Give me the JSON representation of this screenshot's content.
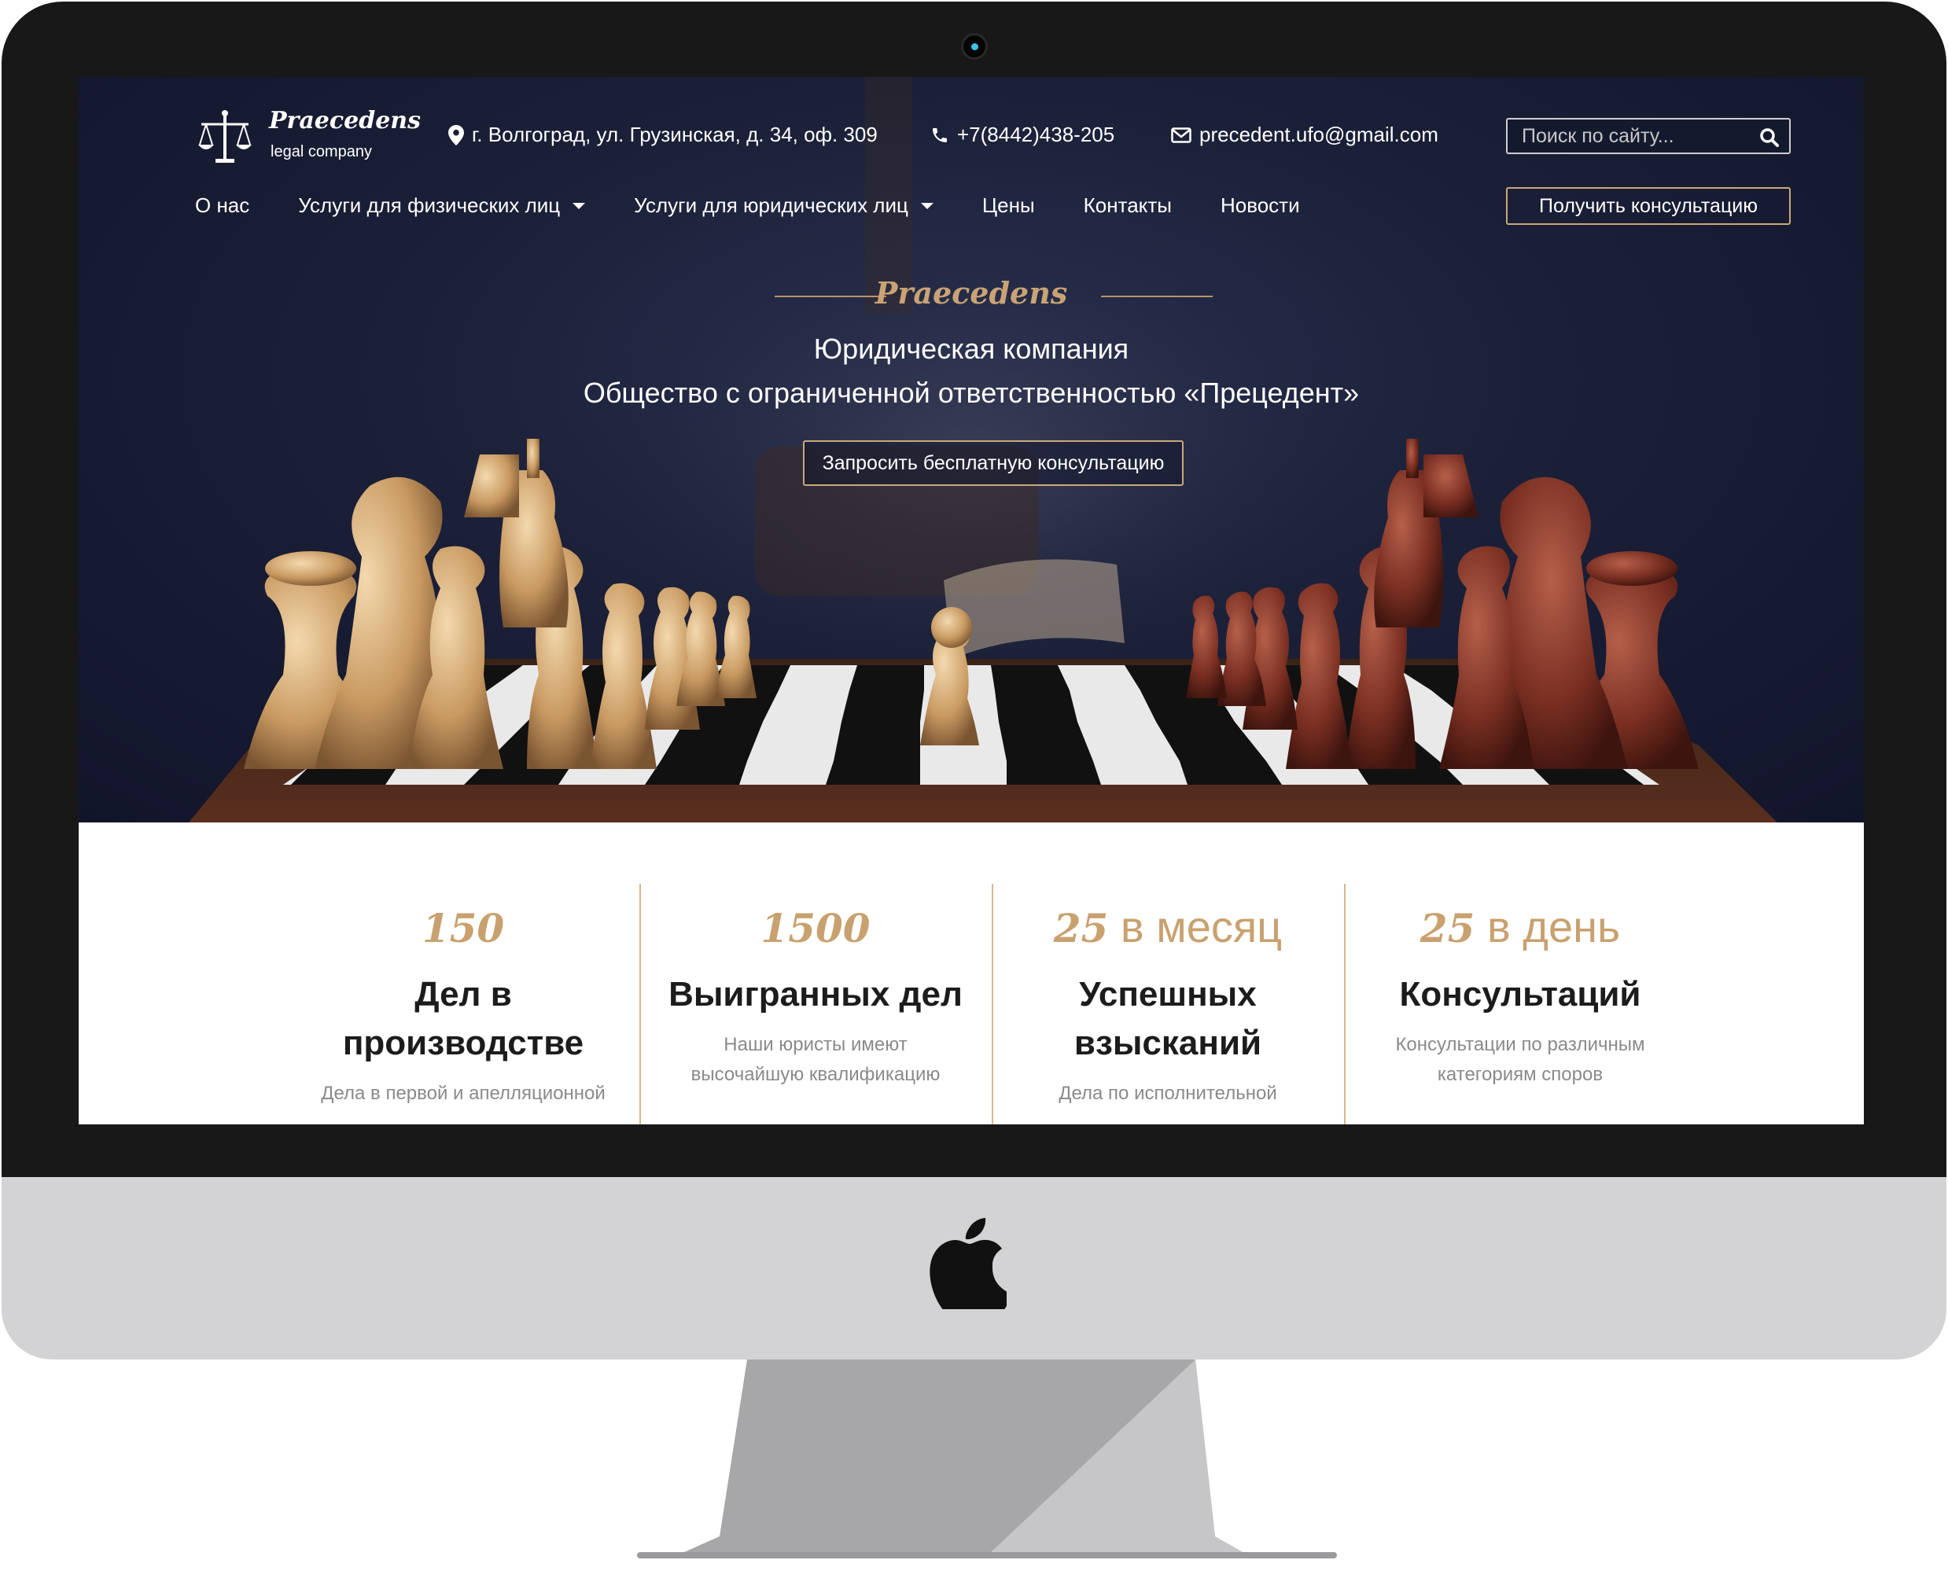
{
  "header": {
    "logo_name": "Praecedens",
    "logo_sub": "legal company",
    "address": "г. Волгоград, ул. Грузинская, д. 34, оф. 309",
    "phone": "+7(8442)438-205",
    "email": "precedent.ufo@gmail.com",
    "search_placeholder": "Поиск по сайту..."
  },
  "nav": {
    "items": [
      {
        "label": "О нас"
      },
      {
        "label": "Услуги для физических лиц"
      },
      {
        "label": "Услуги для юридических лиц"
      },
      {
        "label": "Цены"
      },
      {
        "label": "Контакты"
      },
      {
        "label": "Новости"
      }
    ],
    "cta_label": "Получить консультацию"
  },
  "hero": {
    "brand": "Praecedens",
    "title_line1": "Юридическая компания",
    "title_line2": "Общество с ограниченной ответственностью «Прецедент»",
    "button_label": "Запросить бесплатную консультацию"
  },
  "stats": [
    {
      "number": "150",
      "suffix": "",
      "title_line1": "Дел в",
      "title_line2": "производстве",
      "desc_line1": "Дела в первой и апелляционной",
      "desc_line2": ""
    },
    {
      "number": "1500",
      "suffix": "",
      "title_line1": "Выигранных дел",
      "title_line2": "",
      "desc_line1": "Наши юристы имеют",
      "desc_line2": "высочайшую квалификацию"
    },
    {
      "number": "25",
      "suffix": "в месяц",
      "title_line1": "Успешных",
      "title_line2": "взысканий",
      "desc_line1": "Дела по исполнительной",
      "desc_line2": ""
    },
    {
      "number": "25",
      "suffix": "в день",
      "title_line1": "Консультаций",
      "title_line2": "",
      "desc_line1": "Консультации по различным",
      "desc_line2": "категориям споров"
    }
  ],
  "colors": {
    "accent_gold": "#c8a16f",
    "hero_bg": "#1b2038",
    "bezel": "#181818",
    "chin": "#d3d3d5"
  },
  "icons": [
    "location-pin-icon",
    "phone-icon",
    "envelope-icon",
    "search-icon",
    "caret-down-icon",
    "scales-logo-icon",
    "apple-logo-icon",
    "webcam-icon"
  ]
}
